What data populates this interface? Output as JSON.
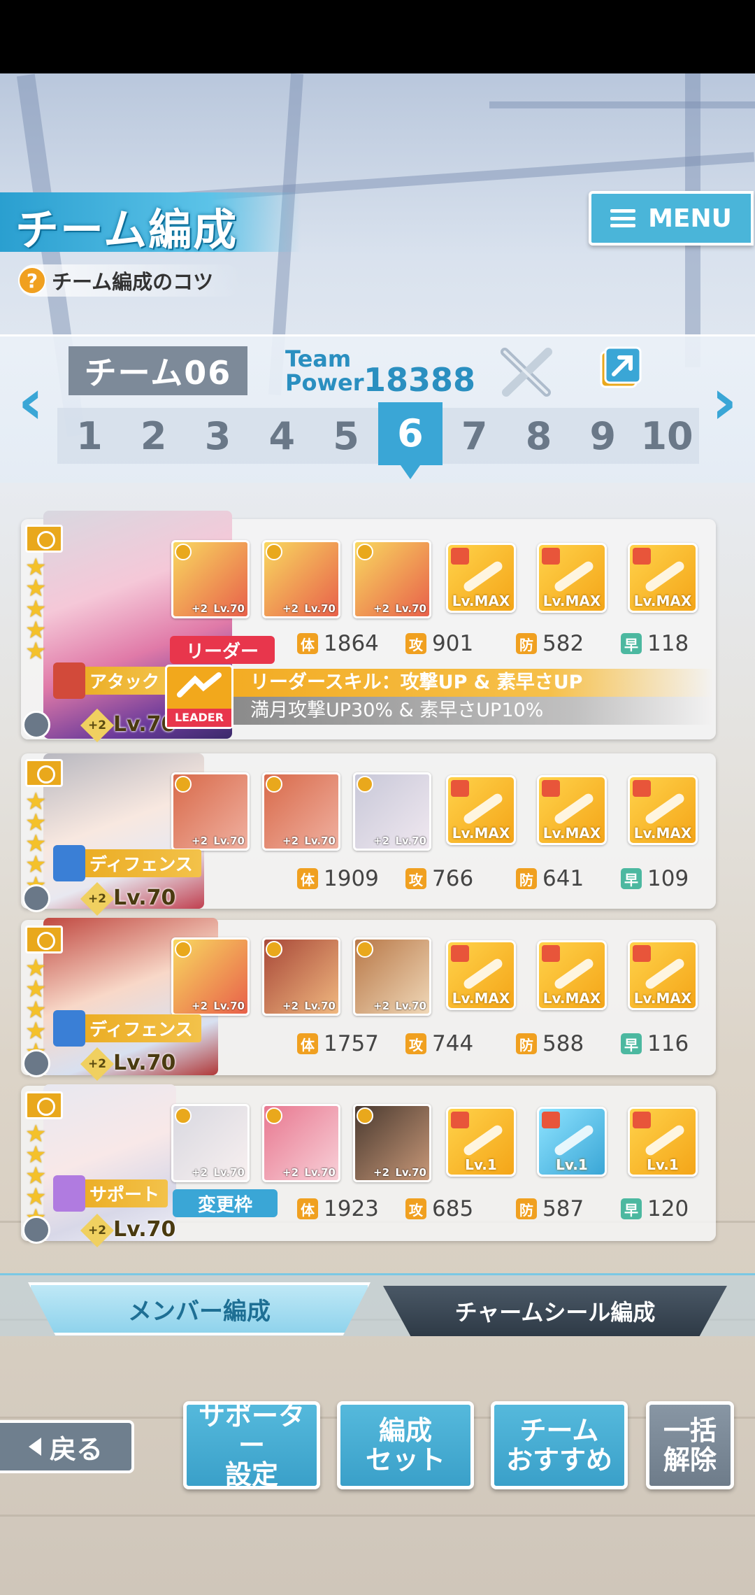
{
  "header": {
    "title": "チーム編成",
    "tips": "チーム編成のコツ",
    "tips_icon": "?",
    "menu_label": "MENU"
  },
  "team": {
    "name": "チーム06",
    "power_label_1": "Team",
    "power_label_2": "Power",
    "power_value": "18388",
    "pages": [
      "1",
      "2",
      "3",
      "4",
      "5",
      "6",
      "7",
      "8",
      "9",
      "10"
    ],
    "active_page": 6,
    "prev_arrow": "‹",
    "next_arrow": "›"
  },
  "stat_labels": {
    "hp": "体",
    "atk": "攻",
    "def": "防",
    "spd": "早"
  },
  "members": [
    {
      "leader_badge": "リーダー",
      "role": "アタック",
      "level": "Lv.70",
      "plus": "+2",
      "supports": [
        {
          "lv": "Lv.70",
          "plus": "+2"
        },
        {
          "lv": "Lv.70",
          "plus": "+2"
        },
        {
          "lv": "Lv.70",
          "plus": "+2"
        }
      ],
      "seals": [
        "Lv.MAX",
        "Lv.MAX",
        "Lv.MAX"
      ],
      "stats": {
        "hp": "1864",
        "atk": "901",
        "def": "582",
        "spd": "118"
      },
      "leader_skill_title": "リーダースキル：攻撃UP & 素早さUP",
      "leader_skill_desc": "満月攻撃UP30% & 素早さUP10%",
      "leader_icon_label": "LEADER"
    },
    {
      "role": "ディフェンス",
      "level": "Lv.70",
      "plus": "+2",
      "supports": [
        {
          "lv": "Lv.70",
          "plus": "+2"
        },
        {
          "lv": "Lv.70",
          "plus": "+2"
        },
        {
          "lv": "Lv.70",
          "plus": "+2"
        }
      ],
      "seals": [
        "Lv.MAX",
        "Lv.MAX",
        "Lv.MAX"
      ],
      "stats": {
        "hp": "1909",
        "atk": "766",
        "def": "641",
        "spd": "109"
      }
    },
    {
      "role": "ディフェンス",
      "level": "Lv.70",
      "plus": "+2",
      "supports": [
        {
          "lv": "Lv.70",
          "plus": "+2"
        },
        {
          "lv": "Lv.70",
          "plus": "+2"
        },
        {
          "lv": "Lv.70",
          "plus": "+2"
        }
      ],
      "seals": [
        "Lv.MAX",
        "Lv.MAX",
        "Lv.MAX"
      ],
      "stats": {
        "hp": "1757",
        "atk": "744",
        "def": "588",
        "spd": "116"
      }
    },
    {
      "change_badge": "変更枠",
      "role": "サポート",
      "level": "Lv.70",
      "plus": "+2",
      "supports": [
        {
          "lv": "Lv.70",
          "plus": "+2"
        },
        {
          "lv": "Lv.70",
          "plus": "+2"
        },
        {
          "lv": "Lv.70",
          "plus": "+2"
        }
      ],
      "seals": [
        "Lv.1",
        "Lv.1",
        "Lv.1"
      ],
      "stats": {
        "hp": "1923",
        "atk": "685",
        "def": "587",
        "spd": "120"
      }
    }
  ],
  "tabs": {
    "member": "メンバー編成",
    "charm_seal": "チャームシール編成"
  },
  "buttons": {
    "back": "戻る",
    "supporter": "サポーター\n設定",
    "formation_set": "編成\nセット",
    "recommend": "チーム\nおすすめ",
    "clear_all": "一括\n解除"
  },
  "colors": {
    "accent": "#3aa6d6",
    "leader_red": "#e8364c",
    "gold": "#e9a81c"
  }
}
